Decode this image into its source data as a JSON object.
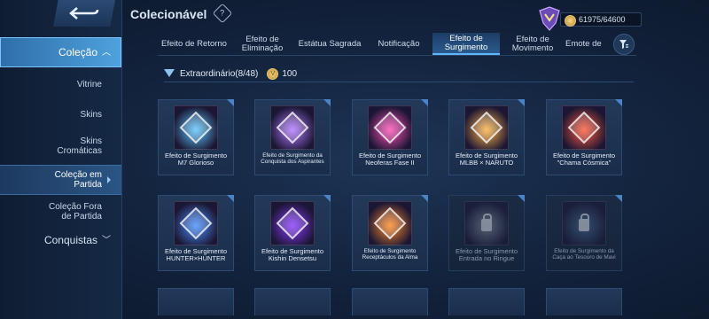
{
  "sidebar": {
    "items": [
      {
        "label": "Coleção",
        "type": "group",
        "active": true
      },
      {
        "label": "Vitrine"
      },
      {
        "label": "Skins"
      },
      {
        "label": "Skins Cromáticas"
      },
      {
        "label": "Coleção em Partida",
        "selected": true
      },
      {
        "label": "Coleção Fora de Partida"
      },
      {
        "label": "Conquistas",
        "type": "group"
      }
    ]
  },
  "header": {
    "title": "Colecionável",
    "currency": "61975/64600"
  },
  "tabs": [
    {
      "label": "Efeito de Retorno"
    },
    {
      "label": "Efeito de Eliminação"
    },
    {
      "label": "Estátua Sagrada"
    },
    {
      "label": "Notificação"
    },
    {
      "label": "Efeito de Surgimento",
      "active": true
    },
    {
      "label": "Efeito de Movimento"
    },
    {
      "label": "Emote de"
    }
  ],
  "section": {
    "title": "Extraordinário(8/48)",
    "points": "100"
  },
  "cards": [
    {
      "name": "Efeito de Surgimento M7 Glorioso",
      "color": "#5ec8ff",
      "locked": false
    },
    {
      "name": "Efeito de Surgimento da Conquista dos Aspirantes",
      "color": "#b37bff",
      "locked": false,
      "small": true
    },
    {
      "name": "Efeito de Surgimento Neoferas Fase II",
      "color": "#ff4fb8",
      "locked": false
    },
    {
      "name": "Efeito de Surgimento MLBB × NARUTO",
      "color": "#ffb347",
      "locked": false
    },
    {
      "name": "Efeito de Surgimento \"Chama Cósmica\"",
      "color": "#ff5a3c",
      "locked": false
    },
    {
      "name": "Efeito de Surgimento HUNTER×HUNTER",
      "color": "#4a90ff",
      "locked": false
    },
    {
      "name": "Efeito de Surgimento Kishin Densetsu",
      "color": "#8a3cff",
      "locked": false
    },
    {
      "name": "Efeito de Surgimento Receptáculos da Alma",
      "color": "#ff8a2a",
      "locked": false,
      "small": true
    },
    {
      "name": "Efeito de Surgimento Entrada no Ringue",
      "color": "#8a8fa0",
      "locked": true
    },
    {
      "name": "Efeito de Surgimento da Caça ao Tesouro de Mavi",
      "color": "#4d6f9a",
      "locked": true,
      "small": true
    }
  ]
}
